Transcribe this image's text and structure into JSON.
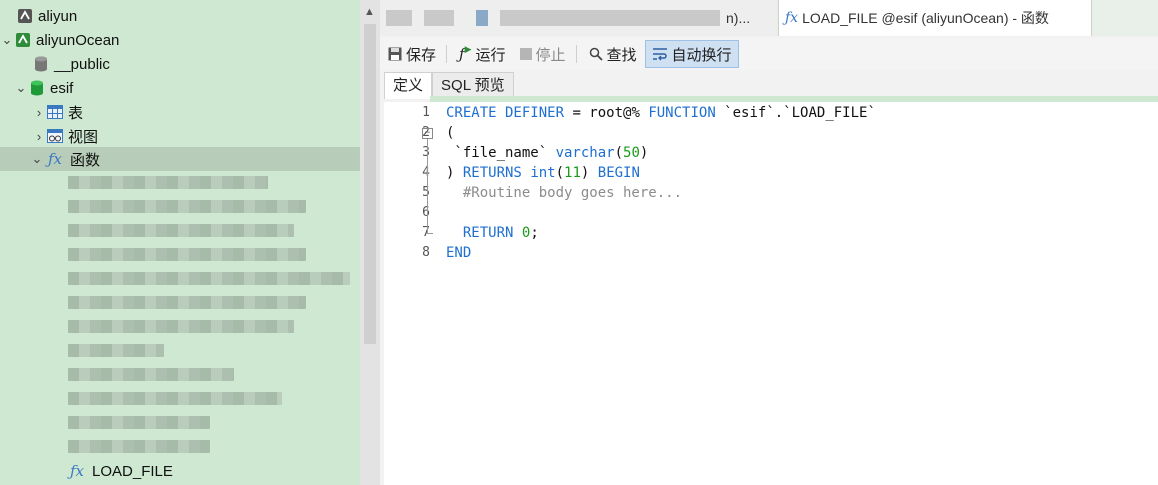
{
  "sidebar": {
    "connection_1": "aliyun",
    "connection_2": "aliyunOcean",
    "schema_public": "__public",
    "schema_esif": "esif",
    "folder_tables": "表",
    "folder_views": "视图",
    "folder_functions": "函数",
    "function_load_file": "LOAD_FILE"
  },
  "tabs": {
    "active_label": "LOAD_FILE @esif (aliyunOcean) - 函数",
    "inactive_partial": "n)..."
  },
  "toolbar": {
    "save": "保存",
    "run": "运行",
    "stop": "停止",
    "find": "查找",
    "word_wrap": "自动换行"
  },
  "subtabs": {
    "definition": "定义",
    "sql_preview": "SQL 预览"
  },
  "editor": {
    "line_numbers": [
      "1",
      "2",
      "3",
      "4",
      "5",
      "6",
      "7",
      "8"
    ],
    "l1": {
      "kw1": "CREATE DEFINER",
      "t1": " = root@% ",
      "kw2": "FUNCTION",
      "t2": " `esif`.`LOAD_FILE`"
    },
    "l2": {
      "t1": "("
    },
    "l3": {
      "t1": " `file_name` ",
      "kw1": "varchar",
      "t2": "(",
      "n1": "50",
      "t3": ")"
    },
    "l4": {
      "t1": ") ",
      "kw1": "RETURNS",
      "t2": " ",
      "kw2": "int",
      "t3": "(",
      "n1": "11",
      "t4": ") ",
      "kw3": "BEGIN"
    },
    "l5": {
      "cm": "  #Routine body goes here..."
    },
    "l7": {
      "sp": "  ",
      "kw1": "RETURN",
      "t1": " ",
      "n1": "0",
      "t2": ";"
    },
    "l8": {
      "kw1": "END"
    }
  },
  "colors": {
    "sidebar_bg": "#cfe8d1",
    "keyword": "#1e6fcf",
    "number": "#1a9a1a",
    "comment": "#8c8c8c"
  }
}
